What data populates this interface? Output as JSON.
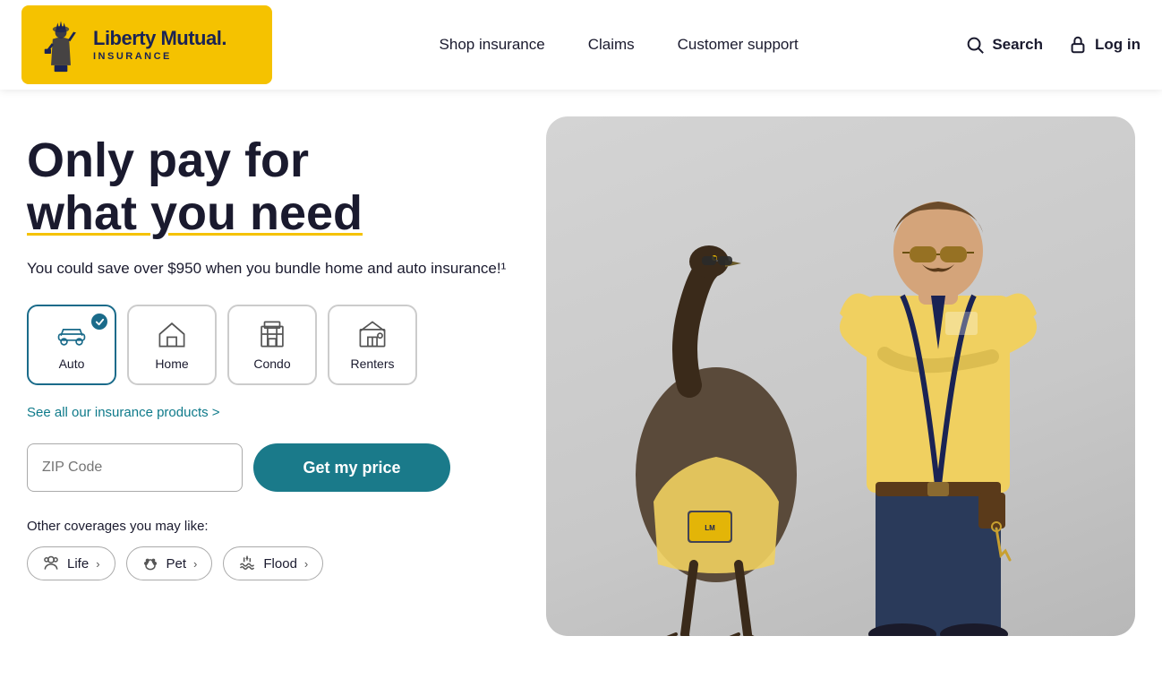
{
  "header": {
    "logo": {
      "name": "Liberty Mutual.",
      "sub": "INSURANCE"
    },
    "nav": [
      {
        "label": "Shop insurance",
        "id": "shop-insurance"
      },
      {
        "label": "Claims",
        "id": "claims"
      },
      {
        "label": "Customer support",
        "id": "customer-support"
      }
    ],
    "search_label": "Search",
    "login_label": "Log in"
  },
  "hero": {
    "headline_line1": "Only pay for",
    "headline_line2": "what you need",
    "subtext": "You could save over $950 when you bundle home and auto insurance!¹",
    "tabs": [
      {
        "label": "Auto",
        "active": true,
        "icon": "car-icon"
      },
      {
        "label": "Home",
        "active": false,
        "icon": "home-icon"
      },
      {
        "label": "Condo",
        "active": false,
        "icon": "condo-icon"
      },
      {
        "label": "Renters",
        "active": false,
        "icon": "renters-icon"
      }
    ],
    "see_all_link": "See all our insurance products >",
    "zip_placeholder": "ZIP Code",
    "cta_button": "Get my price",
    "other_label": "Other coverages you may like:",
    "chips": [
      {
        "label": "Life",
        "icon": "life-icon"
      },
      {
        "label": "Pet",
        "icon": "pet-icon"
      },
      {
        "label": "Flood",
        "icon": "flood-icon"
      }
    ]
  }
}
